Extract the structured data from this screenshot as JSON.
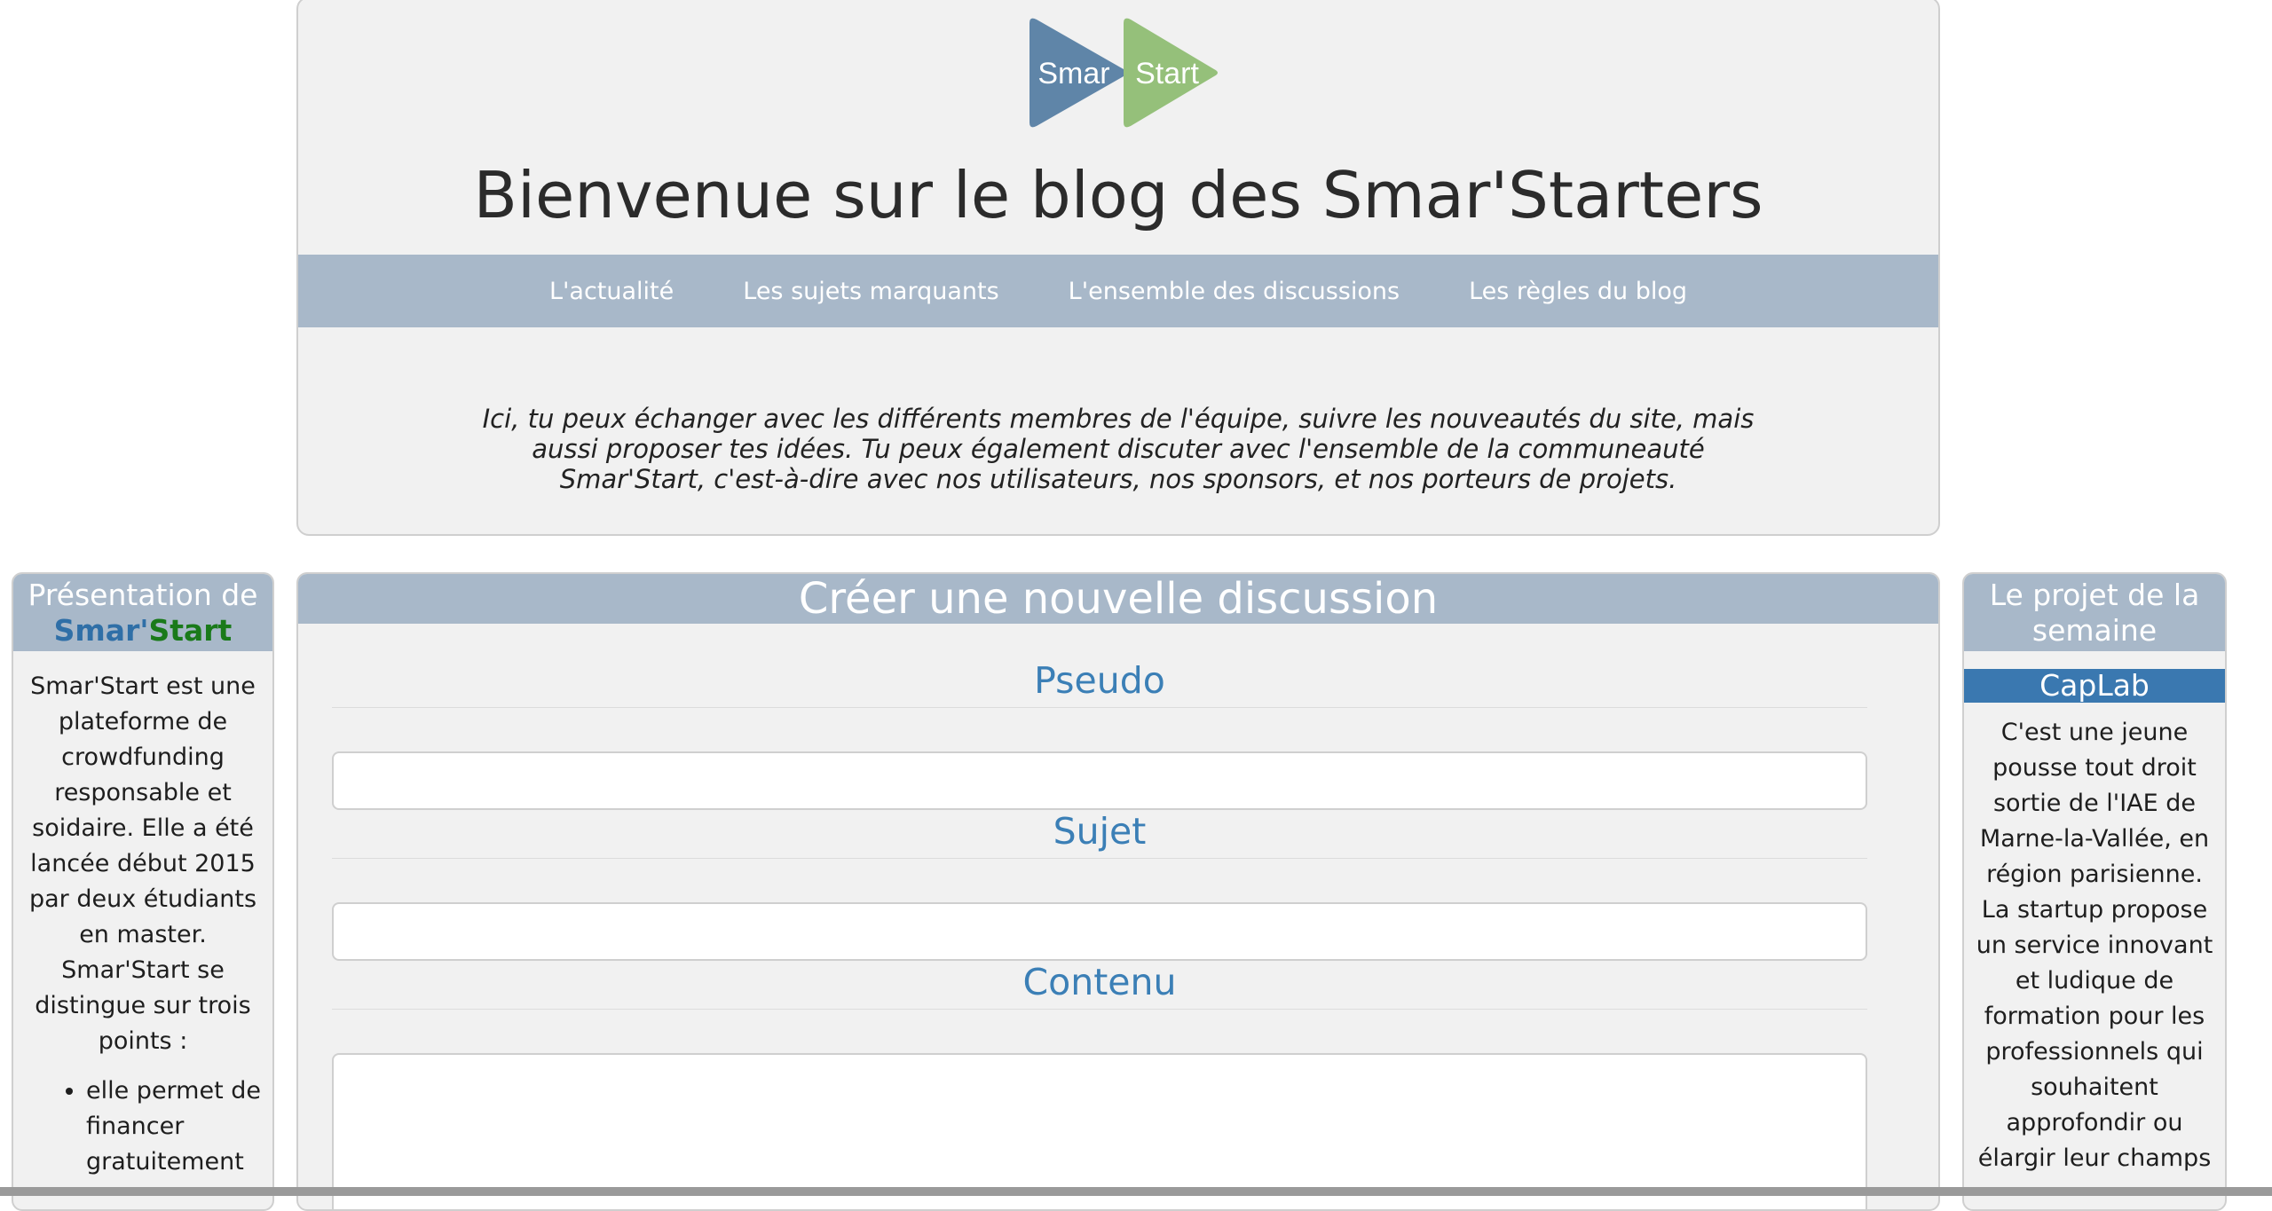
{
  "header": {
    "logo": {
      "left_text": "Smar",
      "right_text": "Start",
      "left_color": "#5f85a8",
      "right_color": "#95c07a"
    },
    "title": "Bienvenue sur le blog des Smar'Starters",
    "nav": [
      "L'actualité",
      "Les sujets marquants",
      "L'ensemble des discussions",
      "Les règles du blog"
    ],
    "intro": "Ici, tu peux échanger avec les différents membres de l'équipe, suivre les nouveautés du site, mais aussi proposer tes idées. Tu peux également discuter avec l'ensemble de la communeauté Smar'Start, c'est-à-dire avec nos utilisateurs, nos sponsors, et nos porteurs de projets."
  },
  "left_panel": {
    "title_prefix": "Présentation de",
    "brand_part1": "Smar'",
    "brand_part2": "Start",
    "body": "Smar'Start est une plateforme de crowdfunding responsable et soidaire. Elle a été lancée début 2015 par deux étudiants en master. Smar'Start se distingue sur trois points :",
    "bullets": [
      "elle permet de financer gratuitement"
    ]
  },
  "main_panel": {
    "title": "Créer une nouvelle discussion",
    "pseudo_label": "Pseudo",
    "sujet_label": "Sujet",
    "contenu_label": "Contenu",
    "pseudo_value": "",
    "sujet_value": "",
    "contenu_value": ""
  },
  "right_panel": {
    "title": "Le projet de la semaine",
    "project_name": "CapLab",
    "body": "C'est une jeune pousse tout droit sortie de l'IAE de Marne-la-Vallée, en région parisienne. La startup propose un service innovant et ludique de formation pour les professionnels qui souhaitent approfondir ou élargir leur champs"
  },
  "colors": {
    "nav_bg": "#a8b8c9",
    "accent_blue": "#3b7fb6",
    "project_bar": "#3a78b0"
  }
}
